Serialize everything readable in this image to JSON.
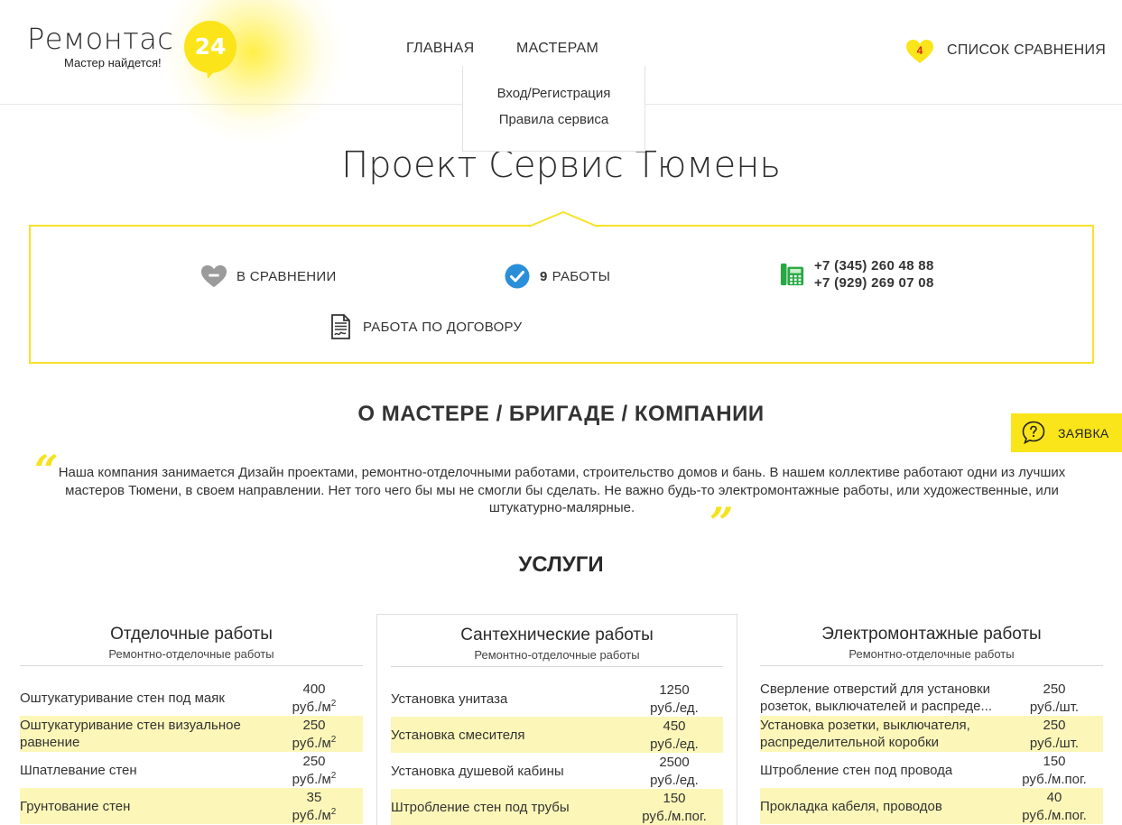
{
  "header": {
    "logo_name": "Ремонтас",
    "logo_number": "24",
    "logo_tagline": "Мастер найдется!",
    "nav": [
      {
        "label": "ГЛАВНАЯ"
      },
      {
        "label": "МАСТЕРАМ"
      }
    ],
    "dropdown": [
      {
        "label": "Вход/Регистрация"
      },
      {
        "label": "Правила сервиса"
      }
    ],
    "compare_count": "4",
    "compare_label": "СПИСОК СРАВНЕНИЯ"
  },
  "page_title": "Проект Сервис Тюмень",
  "info": {
    "in_compare": "В СРАВНЕНИИ",
    "works_count": "9",
    "works_label": "РАБОТЫ",
    "phone_1": "+7 (345) 260 48 88",
    "phone_2": "+7 (929) 269 07 08",
    "contract": "РАБОТА ПО ДОГОВОРУ"
  },
  "about": {
    "title": "О МАСТЕРЕ / БРИГАДЕ / КОМПАНИИ",
    "text": "Наша компания занимается Дизайн проектами, ремонтно-отделочными работами, строительство домов и бань. В нашем коллективе работают одни из лучших мастеров Тюмени, в своем направлении. Нет того чего бы мы не смогли бы сделать. Не важно будь-то электромонтажные работы, или художественные, или штукатурно-малярные."
  },
  "request_button": "ЗАЯВКА",
  "services_title": "УСЛУГИ",
  "services": [
    {
      "title": "Отделочные работы",
      "subtitle": "Ремонтно-отделочные работы",
      "rows": [
        {
          "name": "Оштукатуривание стен под маяк",
          "price": "400",
          "unit": "руб./м",
          "unit_sup": "2"
        },
        {
          "name": "Оштукатуривание стен визуальное равнение",
          "price": "250",
          "unit": "руб./м",
          "unit_sup": "2"
        },
        {
          "name": "Шпатлевание стен",
          "price": "250",
          "unit": "руб./м",
          "unit_sup": "2"
        },
        {
          "name": "Грунтование стен",
          "price": "35",
          "unit": "руб./м",
          "unit_sup": "2"
        }
      ]
    },
    {
      "title": "Сантехнические работы",
      "subtitle": "Ремонтно-отделочные работы",
      "rows": [
        {
          "name": "Установка унитаза",
          "price": "1250",
          "unit": "руб./ед.",
          "unit_sup": ""
        },
        {
          "name": "Установка смесителя",
          "price": "450",
          "unit": "руб./ед.",
          "unit_sup": ""
        },
        {
          "name": "Установка душевой кабины",
          "price": "2500",
          "unit": "руб./ед.",
          "unit_sup": ""
        },
        {
          "name": "Штробление стен под трубы",
          "price": "150",
          "unit": "руб./м.пог.",
          "unit_sup": ""
        }
      ]
    },
    {
      "title": "Электромонтажные работы",
      "subtitle": "Ремонтно-отделочные работы",
      "rows": [
        {
          "name": "Сверление отверстий для установки розеток, выключателей и распреде...",
          "price": "250",
          "unit": "руб./шт.",
          "unit_sup": ""
        },
        {
          "name": "Установка розетки, выключателя, распределительной коробки",
          "price": "250",
          "unit": "руб./шт.",
          "unit_sup": ""
        },
        {
          "name": "Штробление стен под провода",
          "price": "150",
          "unit": "руб./м.пог.",
          "unit_sup": ""
        },
        {
          "name": "Прокладка кабеля, проводов",
          "price": "40",
          "unit": "руб./м.пог.",
          "unit_sup": ""
        }
      ]
    }
  ],
  "colors": {
    "accent_yellow": "#fae51a",
    "highlight_row": "#fcf7b8",
    "check_blue": "#2a8fd8",
    "phone_green": "#27a844",
    "badge_red": "#d8251c"
  }
}
